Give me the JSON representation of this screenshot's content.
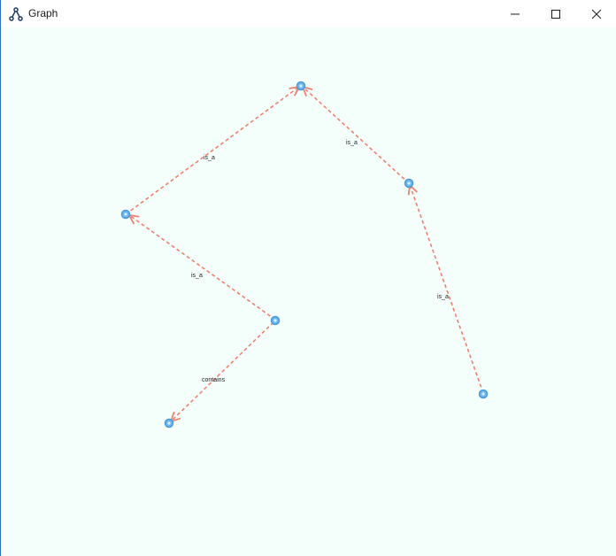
{
  "window": {
    "title": "Graph",
    "app_icon": "graph-hierarchy-icon",
    "controls": {
      "minimize_icon": "minimize-icon",
      "maximize_icon": "maximize-icon",
      "close_icon": "close-icon"
    }
  },
  "colors": {
    "canvas_background": "#f4fffb",
    "node_fill": "#6fb7ee",
    "node_stroke": "#4a9ad8",
    "edge_stroke": "#f08070",
    "label_text": "#222222",
    "window_border": "#2f6fb3"
  },
  "graph": {
    "edges": [
      {
        "label": "is_a"
      },
      {
        "label": "is_a"
      },
      {
        "label": "is_a"
      },
      {
        "label": "is_a"
      },
      {
        "label": "contains"
      }
    ]
  }
}
